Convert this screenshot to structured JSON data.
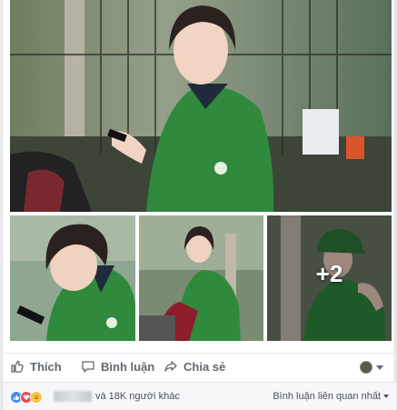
{
  "post": {
    "more_photos": "+2"
  },
  "actions": {
    "like": "Thích",
    "comment": "Bình luận",
    "share": "Chia sẻ"
  },
  "summary": {
    "others": "và 18K người khác",
    "sort": "Bình luận liên quan nhất"
  },
  "colors": {
    "like_blue": "#4a8af4",
    "love_red": "#ed4956",
    "haha_yellow": "#f6c543",
    "shirt_green": "#2f8a3e"
  }
}
